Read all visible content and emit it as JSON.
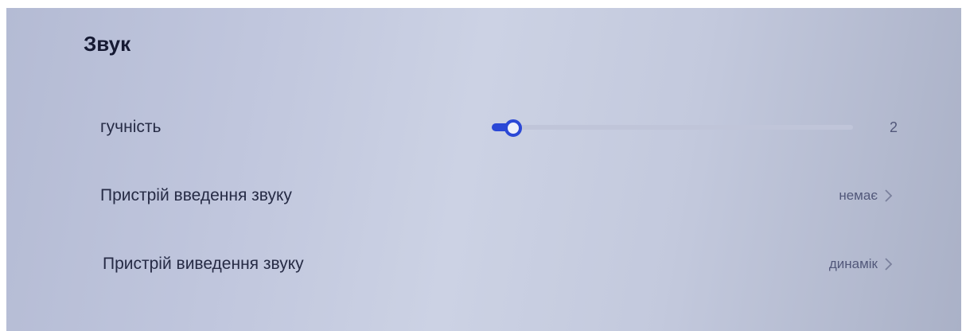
{
  "section": {
    "title": "Звук"
  },
  "volume": {
    "label": "гучність",
    "value": "2",
    "level": 0.02,
    "accent": "#2b48d6"
  },
  "input_device": {
    "label": "Пристрій введення звуку",
    "value": "немає",
    "icon": "chevron-right-icon"
  },
  "output_device": {
    "label": "Пристрій виведення звуку",
    "value": "динамік",
    "icon": "chevron-right-icon"
  }
}
